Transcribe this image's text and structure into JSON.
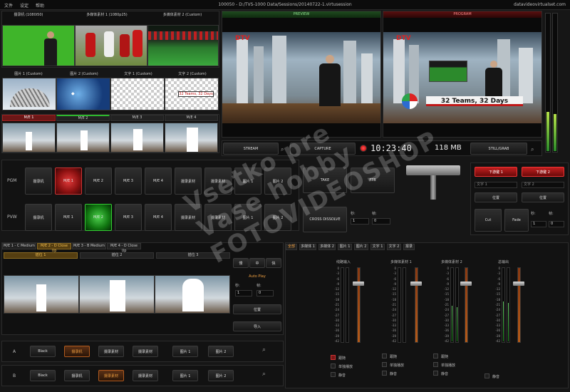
{
  "app": {
    "menu": [
      "文件",
      "设定",
      "帮助"
    ],
    "window_title": "100050 - D:/TVS-1000 Data/Sessions/20140722-1.virtusession",
    "site": "datavideovirtualset.com"
  },
  "sources": {
    "row1": [
      "摄录机 (1080i50)",
      "多媒体素材 1 (1080p25)",
      "多媒体素材 2 (Custom)"
    ],
    "row2": [
      "图片 1 (Custom)",
      "图片 2 (Custom)",
      "文字 1 (Custom)",
      "文字 2 (Custom)"
    ],
    "text_thumb_caption": "32 Teams, 32 Days",
    "me_tabs": [
      "M/E 1",
      "M/E 2",
      "M/E 3",
      "M/E 4"
    ]
  },
  "monitors": {
    "preview_label": "PREVIEW",
    "program_label": "PROGRAM",
    "logo_text": "DTV",
    "lower_third": "32 Teams, 32 Days"
  },
  "transport": {
    "stream": "STREAM",
    "capture": "CAPTURE",
    "timecode": "10:23:40",
    "size": "118 MB",
    "still": "STILL/GRAB"
  },
  "switcher": {
    "pgm_label": "PGM",
    "pvw_label": "PVW",
    "buttons": [
      "摄录机",
      "M/E 1",
      "M/E 2",
      "M/E 3",
      "M/E 4",
      "摄录素材",
      "摄录素材",
      "图片 1",
      "图片 2"
    ],
    "take": "TAKE",
    "ftb": "FTB",
    "cross": "CROSS DISSOLVE",
    "sec_label": "秒:",
    "frame_label": "帧:",
    "sec_val": "1",
    "frame_val": "0"
  },
  "dsk": {
    "dsk1": "下游键 1",
    "dsk2": "下游键 2",
    "text1": "文字 1",
    "text2": "文字 2",
    "pos": "位置",
    "cut": "Cut",
    "fade": "Fade",
    "sec_label": "秒:",
    "frame_label": "帧:",
    "sec_val": "1",
    "frame_val": "0"
  },
  "me_panel": {
    "tabs": [
      "M/E 1 - C Medium",
      "M/E 2 - D Close Up",
      "M/E 3 - B Medium",
      "M/E 4 - D Close Up"
    ],
    "slots": [
      "插位 1",
      "插位 2",
      "插位 3"
    ],
    "speed": [
      "慢",
      "中",
      "快"
    ],
    "autoplay": "Auto Play",
    "sec_label": "秒:",
    "frame_label": "帧:",
    "sec_val": "1",
    "frame_val": "0",
    "position": "位置",
    "import": "导入"
  },
  "ab": {
    "a_label": "A",
    "b_label": "B",
    "a_buttons": [
      "Black",
      "摄录机",
      "摄录素材",
      "摄录素材",
      "图片 1",
      "图片 2"
    ],
    "b_buttons": [
      "Black",
      "摄录机",
      "摄录素材",
      "摄录素材",
      "图片 1",
      "图片 2"
    ]
  },
  "audio": {
    "tabs": [
      "全部",
      "多媒体 1",
      "多媒体 2",
      "图片 1",
      "图片 2",
      "文字 1",
      "文字 2",
      "报录"
    ],
    "channels": [
      "线路输入",
      "多媒体素材 1",
      "多媒体素材 2",
      "总输出"
    ],
    "scale": [
      "0",
      "-3",
      "-6",
      "-9",
      "-12",
      "-15",
      "-18",
      "-21",
      "-24",
      "-27",
      "-30",
      "-33",
      "-36",
      "-39",
      "-42"
    ],
    "ch_checks": [
      "跟随",
      "单独播放",
      "静音"
    ],
    "master_checks": [
      "静音"
    ]
  },
  "watermark": "Vsetko pre Vase hobby FOTOVIDEOSHOP"
}
